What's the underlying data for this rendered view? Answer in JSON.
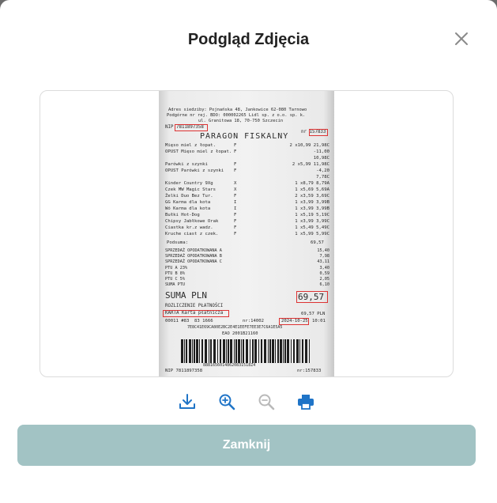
{
  "dialog": {
    "title": "Podgląd Zdjęcia",
    "close_icon": "close-icon",
    "close_button_label": "Zamknij"
  },
  "toolbar": {
    "icons": [
      "download-icon",
      "zoom-in-icon",
      "zoom-out-icon",
      "print-icon"
    ],
    "zoom_out_disabled": true
  },
  "colors": {
    "accent": "#1f74c7",
    "button": "#a2c3c4",
    "disabled": "#b9b9b9",
    "highlight": "#d33333"
  },
  "receipt": {
    "header_1": "Adres siedziby: Pojnańska 48, Jankowice 62-080 Tarnowo",
    "header_2": "Podgórne nr rej. BDO: 000002265 Lidl sp. z o.o. sp. k.",
    "header_3": "ul. Granitowa 18, 70-750 Szczecin",
    "nip": "NIP 7811897358",
    "receipt_no": "nr 157833",
    "paragon": "PARAGON FISKALNY",
    "lines": [
      {
        "name": "Mięso miel z łopat.",
        "tax": "F",
        "price": "2 x10,99 21,98C"
      },
      {
        "name": "OPUST Mięso miel z łopat.",
        "tax": "F",
        "price": "-11,00"
      },
      {
        "name": "",
        "tax": "",
        "price": "10,98C"
      },
      {
        "name": "Parówki z szynki",
        "tax": "F",
        "price": "2 x5,99 11,98C"
      },
      {
        "name": "OPUST Parówki z szynki",
        "tax": "F",
        "price": "-4,20"
      },
      {
        "name": "",
        "tax": "",
        "price": "7,78C"
      },
      {
        "name": "Kinder Country 9Xg",
        "tax": "X",
        "price": "1 x8,79 8,79A"
      },
      {
        "name": "Czek MW Magic Stars",
        "tax": "X",
        "price": "1 x5,69 5,69A"
      },
      {
        "name": "Żelki Duo Bez Tur.",
        "tax": "F",
        "price": "2 x3,59 3,69C"
      },
      {
        "name": "GG Karma dla kota",
        "tax": "I",
        "price": "1 x3,99 3,99B"
      },
      {
        "name": "Wó Karma dla kota",
        "tax": "I",
        "price": "1 x3,99 3,99B"
      },
      {
        "name": "Bułki Hot-Dog",
        "tax": "F",
        "price": "1 x5,19 5,19C"
      },
      {
        "name": "Chipsy Jabłkowe Orak",
        "tax": "F",
        "price": "1 x3,99 3,99C"
      },
      {
        "name": "Ciastka kr.z wadz.",
        "tax": "F",
        "price": "1 x5,49 5,49C"
      },
      {
        "name": "Kruche ciast z czek.",
        "tax": "F",
        "price": "1 x5,99 5,99C"
      }
    ],
    "podsuma_label": "Podsuma:",
    "podsuma": "69,57",
    "vat_lines": [
      {
        "label": "SPRZEDAŻ OPODATKOWANA A",
        "value": "15,40"
      },
      {
        "label": "SPRZEDAŻ OPODATKOWANA B",
        "value": "7,98"
      },
      {
        "label": "SPRZEDAŻ OPODATKOWANA C",
        "value": "43,11"
      },
      {
        "label": "PTU A 23%",
        "value": "3,40"
      },
      {
        "label": "PTU B 8%",
        "value": "0,59"
      },
      {
        "label": "PTU C 5%",
        "value": "2,05"
      },
      {
        "label": "SUMA PTU",
        "value": "6,10"
      }
    ],
    "suma_label": "SUMA PLN",
    "suma": "69,57",
    "rozliczenie": "ROZLICZENIE PŁATNOŚCI",
    "karta": "KARTA Karta płatnicza",
    "karta_value": "69,57 PLN",
    "footer_1": "00011 #83  83 1666",
    "footer_nr": "nr:14002",
    "date": "2024-10-25",
    "time": "10:01",
    "code_1": "7E8C41E69CA80E2BC2E4E1EEFE7EE3E7C6A1E5A5",
    "code_2": "EAO 2001B21160",
    "barcode_num": "88816560148620831518Z4",
    "nip_bottom": "NIP 7811897358",
    "nr_bottom": "nr:157833"
  }
}
